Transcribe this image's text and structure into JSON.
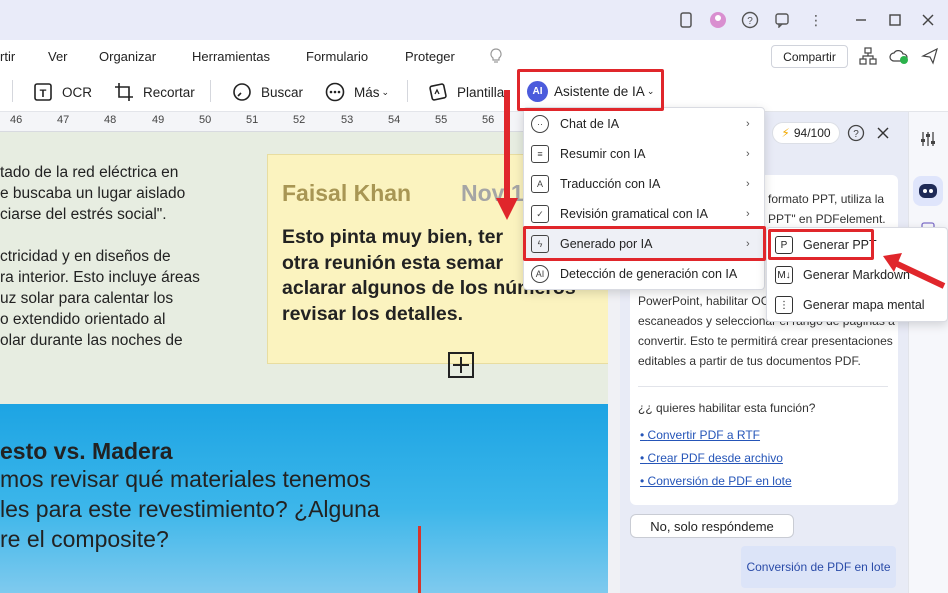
{
  "menubar": {
    "items": [
      "rtir",
      "Ver",
      "Organizar",
      "Herramientas",
      "Formulario",
      "Proteger"
    ],
    "share_label": "Compartir"
  },
  "toolbar": {
    "ocr_label": "OCR",
    "crop_label": "Recortar",
    "search_label": "Buscar",
    "more_label": "Más",
    "template_label": "Plantilla",
    "ai_label": "Asistente de IA",
    "ai_badge": "AI"
  },
  "ruler": {
    "ticks": [
      "46",
      "47",
      "48",
      "49",
      "50",
      "51",
      "52",
      "53",
      "54",
      "55",
      "56"
    ]
  },
  "document": {
    "lines": [
      "tado de la red eléctrica en",
      "e buscaba un lugar aislado",
      "ciarse del estrés social\".",
      "",
      "ctricidad y en diseños de",
      "ra interior. Esto incluye áreas",
      "uz solar para calentar los",
      "o extendido orientado al",
      "olar durante las noches de"
    ],
    "sticky_name": "Faisal Khan",
    "sticky_date": "Nov 1",
    "sticky_lines": [
      "Esto pinta muy bien, ter",
      "otra reunión esta semar",
      "aclarar algunos de los números",
      "revisar los detalles."
    ],
    "photo_heading": "esto vs. Madera",
    "photo_lines": [
      "mos revisar qué materiales tenemos",
      "les para este revestimiento? ¿Alguna",
      "re el composite?"
    ]
  },
  "ai_menu": {
    "items": [
      {
        "label": "Chat de IA",
        "arrow": "›"
      },
      {
        "label": "Resumir con IA",
        "arrow": "›"
      },
      {
        "label": "Traducción con IA",
        "arrow": "›"
      },
      {
        "label": "Revisión gramatical con IA",
        "arrow": "›"
      },
      {
        "label": "Generado por IA",
        "arrow": "›"
      },
      {
        "label": "Detección de generación con IA",
        "arrow": ""
      }
    ],
    "submenu": [
      "Generar PPT",
      "Generar Markdown",
      "Generar mapa mental"
    ]
  },
  "panel": {
    "counter": "94/100",
    "text_lines": [
      "formato PPT, utiliza la",
      "PPT\" en PDFelement.",
      "PowerPoint, habilitar OC",
      "escaneados y seleccionar el rango de páginas a",
      "convertir. Esto te permitirá crear presentaciones",
      "editables a partir de tus documentos PDF."
    ],
    "question": "¿¿ quieres habilitar esta función?",
    "links": [
      "Convertir PDF a RTF",
      "Crear PDF desde archivo",
      "Conversión de PDF en lote"
    ],
    "no_button": "No, solo respóndeme",
    "suggestion": "Conversión de PDF en lote"
  },
  "colors": {
    "highlight": "#e0262b",
    "ai_badge": "#4b5bdc"
  }
}
